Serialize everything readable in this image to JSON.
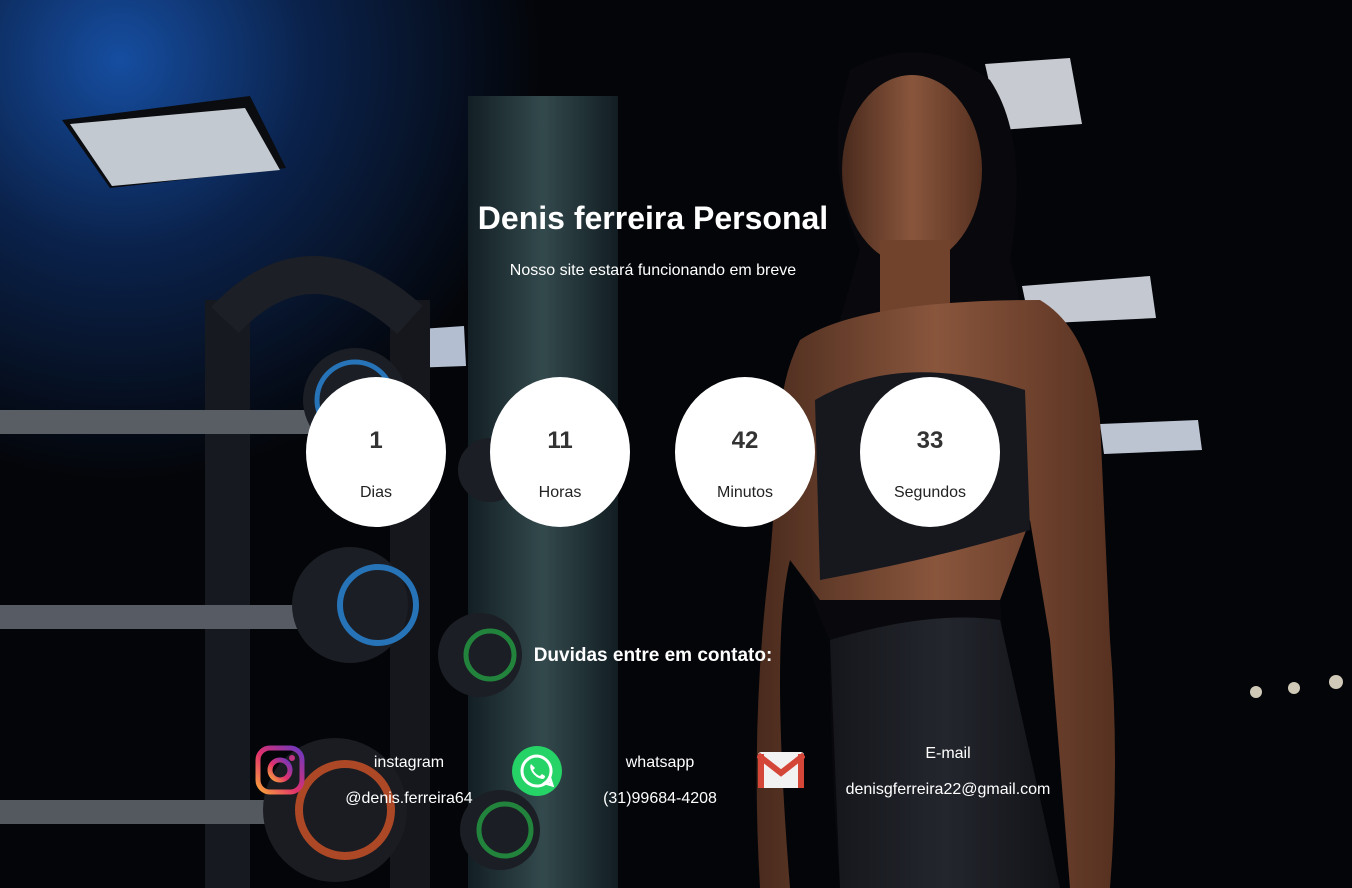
{
  "header": {
    "title": "Denis ferreira Personal",
    "subtitle": "Nosso site estará funcionando em breve"
  },
  "countdown": [
    {
      "value": "1",
      "label": "Dias"
    },
    {
      "value": "11",
      "label": "Horas"
    },
    {
      "value": "42",
      "label": "Minutos"
    },
    {
      "value": "33",
      "label": "Segundos"
    }
  ],
  "contact": {
    "heading": "Duvidas entre em contato:",
    "instagram": {
      "label": "instagram",
      "handle": "@denis.ferreira64",
      "icon": "instagram-icon"
    },
    "whatsapp": {
      "label": "whatsapp",
      "number": "(31)99684-4208",
      "icon": "whatsapp-icon"
    },
    "email": {
      "label": "E-mail",
      "address": "denisgferreira22@gmail.com",
      "icon": "gmail-icon"
    }
  },
  "colors": {
    "text": "#ffffff",
    "circle_bg": "#ffffff",
    "circle_text": "#333333",
    "whatsapp_green": "#25d366",
    "gmail_red": "#d44638"
  }
}
